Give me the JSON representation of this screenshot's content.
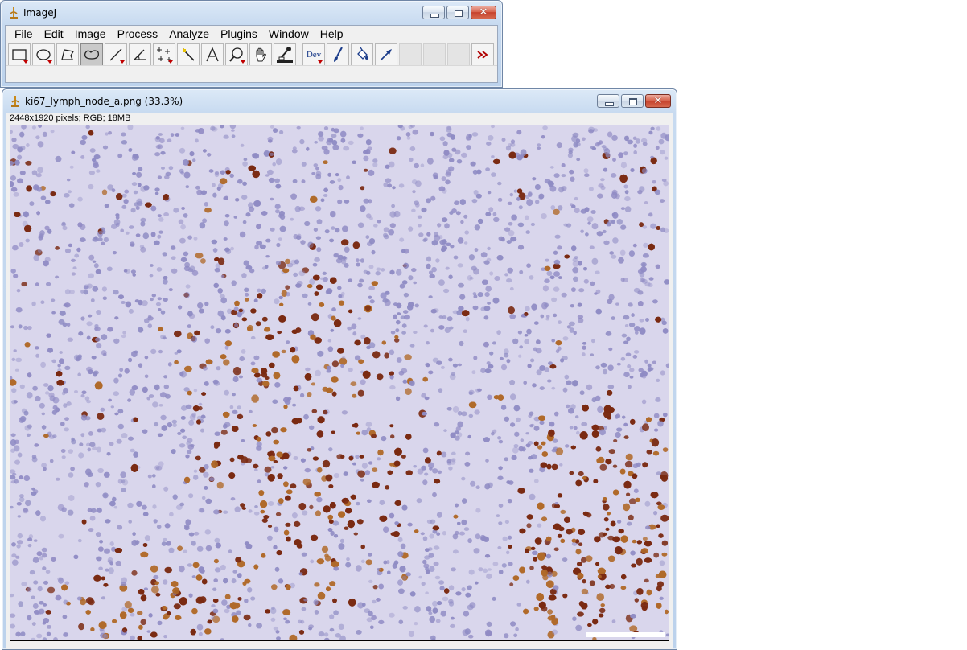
{
  "main_window": {
    "title": "ImageJ",
    "menus": [
      "File",
      "Edit",
      "Image",
      "Process",
      "Analyze",
      "Plugins",
      "Window",
      "Help"
    ],
    "tools": [
      {
        "name": "rectangle-tool",
        "icon": "rectangle-icon",
        "has_menu": true
      },
      {
        "name": "oval-tool",
        "icon": "oval-icon",
        "has_menu": true
      },
      {
        "name": "polygon-tool",
        "icon": "polygon-icon",
        "has_menu": false
      },
      {
        "name": "freehand-tool",
        "icon": "freehand-icon",
        "has_menu": false,
        "active": true
      },
      {
        "name": "line-tool",
        "icon": "line-icon",
        "has_menu": true
      },
      {
        "name": "angle-tool",
        "icon": "angle-icon",
        "has_menu": false
      },
      {
        "name": "point-tool",
        "icon": "multipoint-icon",
        "has_menu": true
      },
      {
        "name": "wand-tool",
        "icon": "wand-icon",
        "has_menu": false
      },
      {
        "name": "text-tool",
        "icon": "text-icon",
        "label": "A",
        "has_menu": false
      },
      {
        "name": "zoom-tool",
        "icon": "magnifier-icon",
        "has_menu": true
      },
      {
        "name": "hand-tool",
        "icon": "hand-icon",
        "has_menu": false
      },
      {
        "name": "dropper-tool",
        "icon": "color-picker-icon",
        "has_menu": false
      },
      {
        "name": "developer-menu",
        "icon": "dev-icon",
        "label": "Dev",
        "has_menu": true
      },
      {
        "name": "brush-tool",
        "icon": "brush-icon",
        "has_menu": false
      },
      {
        "name": "flood-fill-tool",
        "icon": "flood-fill-icon",
        "has_menu": false
      },
      {
        "name": "arrow-tool",
        "icon": "arrow-icon",
        "has_menu": false
      }
    ],
    "more_tools_icon": "double-chevron-right-icon"
  },
  "image_window": {
    "title": "ki67_lymph_node_a.png (33.3%)",
    "info": "2448x1920 pixels; RGB; 18MB",
    "zoom_percent": 33.3,
    "colors": {
      "background": "#d9d6ec",
      "hematoxylin_nuclei": "#8f8bc4",
      "dab_positive": "#7a2a12",
      "dab_light": "#b06a2a"
    }
  }
}
